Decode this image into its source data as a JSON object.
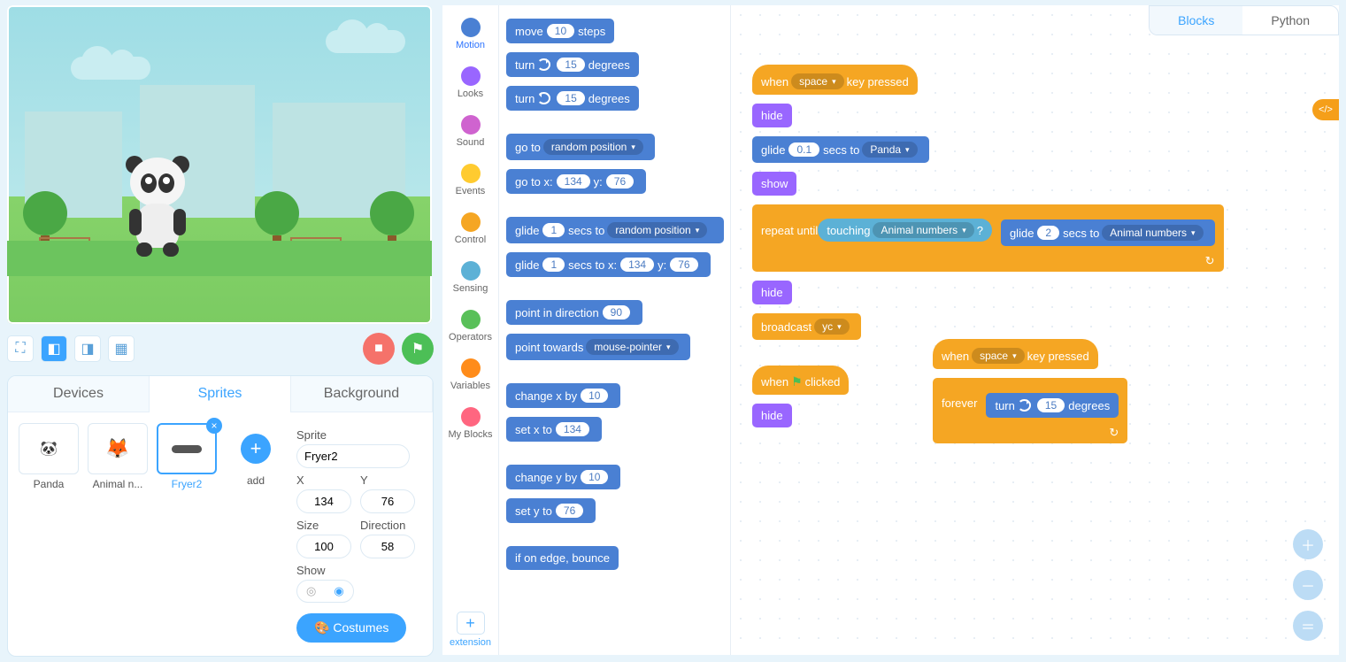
{
  "stage_controls": {
    "stop_label": "Stop",
    "flag_label": "Go"
  },
  "asset_tabs": {
    "devices": "Devices",
    "sprites": "Sprites",
    "background": "Background"
  },
  "sprites": [
    {
      "name": "Panda"
    },
    {
      "name": "Animal n..."
    },
    {
      "name": "Fryer2"
    }
  ],
  "add_label": "add",
  "sprite_props": {
    "sprite_lbl": "Sprite",
    "sprite_val": "Fryer2",
    "x_lbl": "X",
    "x_val": "134",
    "y_lbl": "Y",
    "y_val": "76",
    "size_lbl": "Size",
    "size_val": "100",
    "dir_lbl": "Direction",
    "dir_val": "58",
    "show_lbl": "Show",
    "costumes_btn": "Costumes"
  },
  "categories": [
    {
      "name": "Motion",
      "color": "#4a80d3",
      "active": true
    },
    {
      "name": "Looks",
      "color": "#9966ff"
    },
    {
      "name": "Sound",
      "color": "#cf63cf"
    },
    {
      "name": "Events",
      "color": "#ffcb30"
    },
    {
      "name": "Control",
      "color": "#f5a623"
    },
    {
      "name": "Sensing",
      "color": "#5cb1d6"
    },
    {
      "name": "Operators",
      "color": "#59c059"
    },
    {
      "name": "Variables",
      "color": "#ff8c1a"
    },
    {
      "name": "My Blocks",
      "color": "#ff6680"
    }
  ],
  "ext_label": "extension",
  "palette": {
    "move": {
      "pre": "move",
      "val": "10",
      "post": "steps"
    },
    "turn_cw": {
      "pre": "turn",
      "val": "15",
      "post": "degrees"
    },
    "turn_ccw": {
      "pre": "turn",
      "val": "15",
      "post": "degrees"
    },
    "goto_rand": {
      "pre": "go to",
      "drop": "random position"
    },
    "goto_xy": {
      "pre": "go to x:",
      "x": "134",
      "mid": "y:",
      "y": "76"
    },
    "glide_rand": {
      "pre": "glide",
      "v": "1",
      "mid": "secs to",
      "drop": "random position"
    },
    "glide_xy": {
      "pre": "glide",
      "v": "1",
      "mid": "secs to x:",
      "x": "134",
      "mid2": "y:",
      "y": "76"
    },
    "point_dir": {
      "pre": "point in direction",
      "v": "90"
    },
    "point_to": {
      "pre": "point towards",
      "drop": "mouse-pointer"
    },
    "chg_x": {
      "pre": "change x by",
      "v": "10"
    },
    "set_x": {
      "pre": "set x to",
      "v": "134"
    },
    "chg_y": {
      "pre": "change y by",
      "v": "10"
    },
    "set_y": {
      "pre": "set y to",
      "v": "76"
    },
    "bounce": {
      "txt": "if on edge, bounce"
    }
  },
  "ws_tabs": {
    "blocks": "Blocks",
    "python": "Python"
  },
  "scripts": {
    "s1": {
      "when_key": {
        "pre": "when",
        "key": "space",
        "post": "key pressed"
      },
      "hide1": "hide",
      "glide1": {
        "pre": "glide",
        "v": "0.1",
        "mid": "secs to",
        "drop": "Panda"
      },
      "show": "show",
      "repeat": {
        "pre": "repeat until",
        "touch_pre": "touching",
        "touch_drop": "Animal numbers",
        "q": "?"
      },
      "glide_in": {
        "pre": "glide",
        "v": "2",
        "mid": "secs to",
        "drop": "Animal numbers"
      },
      "hide2": "hide",
      "broadcast": {
        "pre": "broadcast",
        "drop": "yc"
      }
    },
    "s2": {
      "when_flag": {
        "pre": "when",
        "post": "clicked"
      },
      "hide": "hide"
    },
    "s3": {
      "when_key": {
        "pre": "when",
        "key": "space",
        "post": "key pressed"
      },
      "forever": "forever",
      "turn": {
        "pre": "turn",
        "v": "15",
        "post": "degrees"
      }
    }
  },
  "code_toggle": "</>"
}
